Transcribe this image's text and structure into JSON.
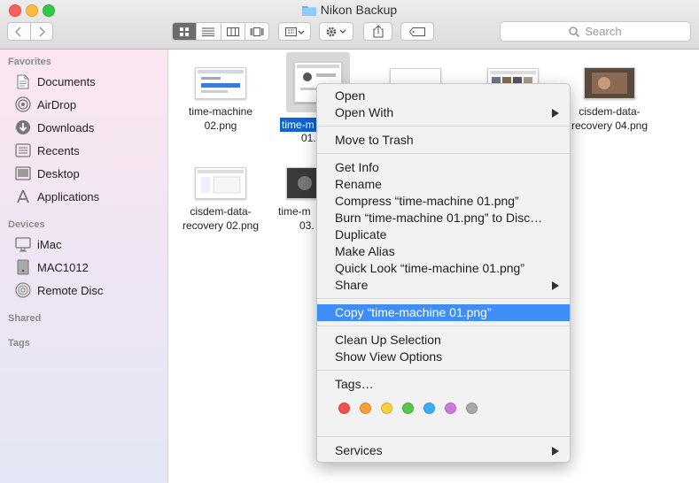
{
  "window": {
    "title": "Nikon Backup"
  },
  "toolbar": {
    "search_placeholder": "Search"
  },
  "sidebar": {
    "favorites_header": "Favorites",
    "favorites": [
      "Documents",
      "AirDrop",
      "Downloads",
      "Recents",
      "Desktop",
      "Applications"
    ],
    "devices_header": "Devices",
    "devices": [
      "iMac",
      "MAC1012",
      "Remote Disc"
    ],
    "shared_header": "Shared",
    "tags_header": "Tags"
  },
  "files": {
    "f1_line1": "time-machine",
    "f1_line2": "02.png",
    "f2_selected_line1": "time-m",
    "f2_selected_line2": "01.",
    "f3_line1": "cisdem-data-",
    "f3_line2": "recovery 04.png",
    "f4_line1": "cisdem-data-",
    "f4_line2": "recovery 02.png",
    "f5_line1": "time-m",
    "f5_line2": "03."
  },
  "context_menu": {
    "open": "Open",
    "open_with": "Open With",
    "move_to_trash": "Move to Trash",
    "get_info": "Get Info",
    "rename": "Rename",
    "compress": "Compress “time-machine 01.png”",
    "burn": "Burn “time-machine 01.png” to Disc…",
    "duplicate": "Duplicate",
    "make_alias": "Make Alias",
    "quick_look": "Quick Look “time-machine 01.png”",
    "share": "Share",
    "copy": "Copy “time-machine 01.png”",
    "clean_up": "Clean Up Selection",
    "show_view_options": "Show View Options",
    "tags": "Tags…",
    "services": "Services",
    "tag_colors": [
      "#f0504d",
      "#f4a236",
      "#f8cf3c",
      "#5bc44b",
      "#3eaef4",
      "#cc7ad9",
      "#a8a8a8"
    ]
  }
}
